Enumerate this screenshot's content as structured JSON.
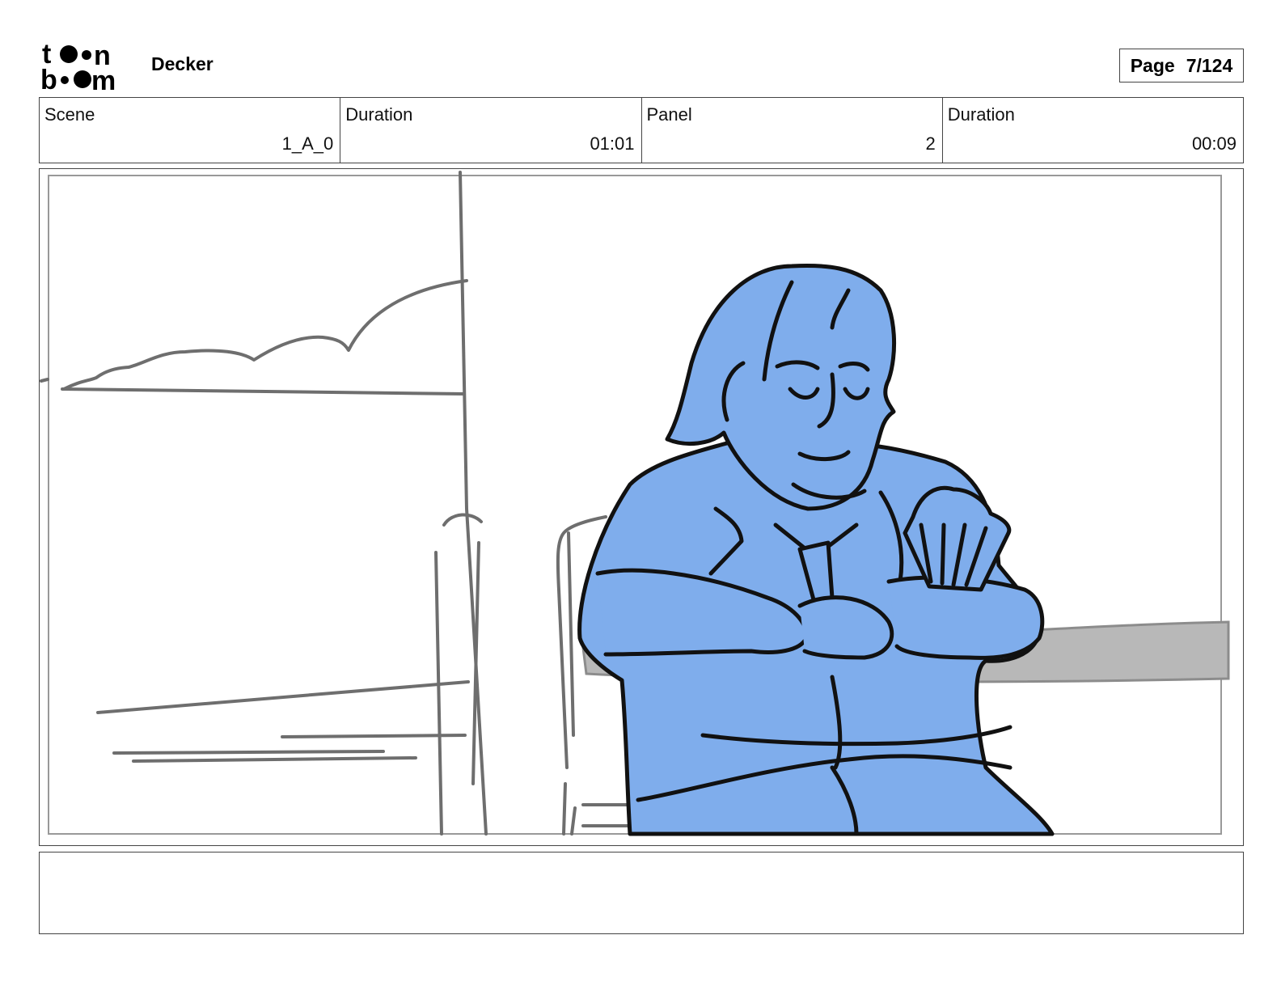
{
  "header": {
    "logo_text": [
      "to",
      "on",
      "bo",
      "om"
    ],
    "project_name": "Decker",
    "page_label": "Page",
    "page_value": "7/124"
  },
  "info": {
    "scene_label": "Scene",
    "scene_value": "1_A_0",
    "scene_duration_label": "Duration",
    "scene_duration_value": "01:01",
    "panel_label": "Panel",
    "panel_value": "2",
    "panel_duration_label": "Duration",
    "panel_duration_value": "00:09"
  },
  "notes": {
    "text": ""
  },
  "colors": {
    "character_fill": "#7fadec",
    "table_fill": "#b8b8b8",
    "sketch_gray": "#6e6e6e",
    "border": "#444444"
  }
}
